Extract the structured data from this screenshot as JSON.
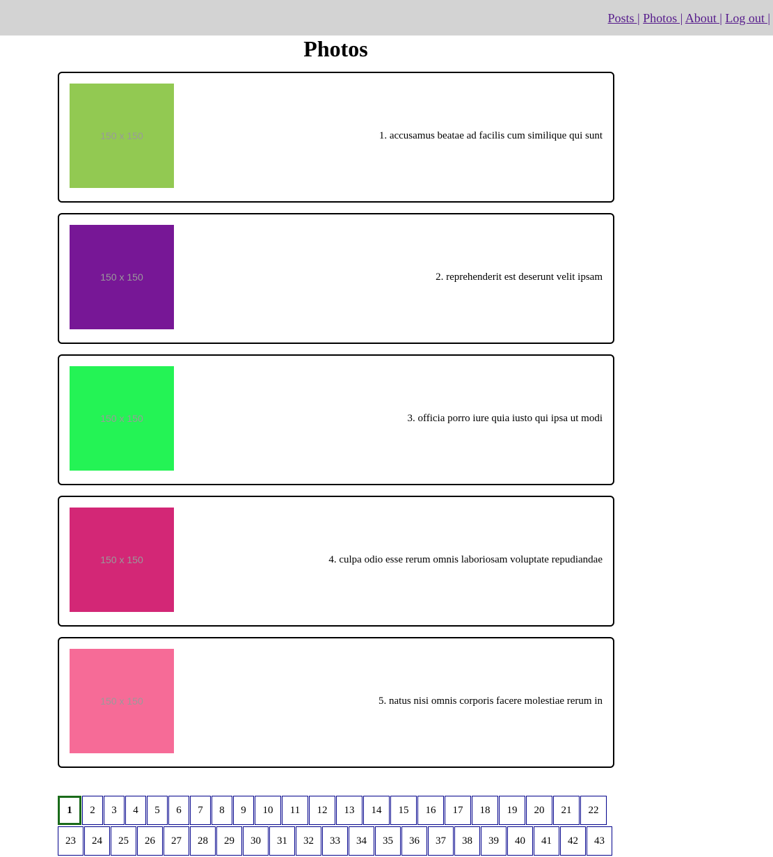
{
  "nav": {
    "links": [
      "Posts |",
      "Photos |",
      "About |",
      "Log out |"
    ]
  },
  "page": {
    "title": "Photos"
  },
  "photos": [
    {
      "caption": "1. accusamus beatae ad facilis cum similique qui sunt",
      "placeholder": "150 x 150",
      "color": "#92c952"
    },
    {
      "caption": "2. reprehenderit est deserunt velit ipsam",
      "placeholder": "150 x 150",
      "color": "#771796"
    },
    {
      "caption": "3. officia porro iure quia iusto qui ipsa ut modi",
      "placeholder": "150 x 150",
      "color": "#24f355"
    },
    {
      "caption": "4. culpa odio esse rerum omnis laboriosam voluptate repudiandae",
      "placeholder": "150 x 150",
      "color": "#d32776"
    },
    {
      "caption": "5. natus nisi omnis corporis facere molestiae rerum in",
      "placeholder": "150 x 150",
      "color": "#f66b97"
    }
  ],
  "pagination": {
    "current": "1",
    "row1": [
      "1",
      "2",
      "3",
      "4",
      "5",
      "6",
      "7",
      "8",
      "9",
      "10",
      "11",
      "12",
      "13",
      "14",
      "15",
      "16",
      "17",
      "18",
      "19",
      "20",
      "21",
      "22"
    ],
    "row2": [
      "23",
      "24",
      "25",
      "26",
      "27",
      "28",
      "29",
      "30",
      "31",
      "32",
      "33",
      "34",
      "35",
      "36",
      "37",
      "38",
      "39",
      "40",
      "41",
      "42",
      "43"
    ]
  }
}
